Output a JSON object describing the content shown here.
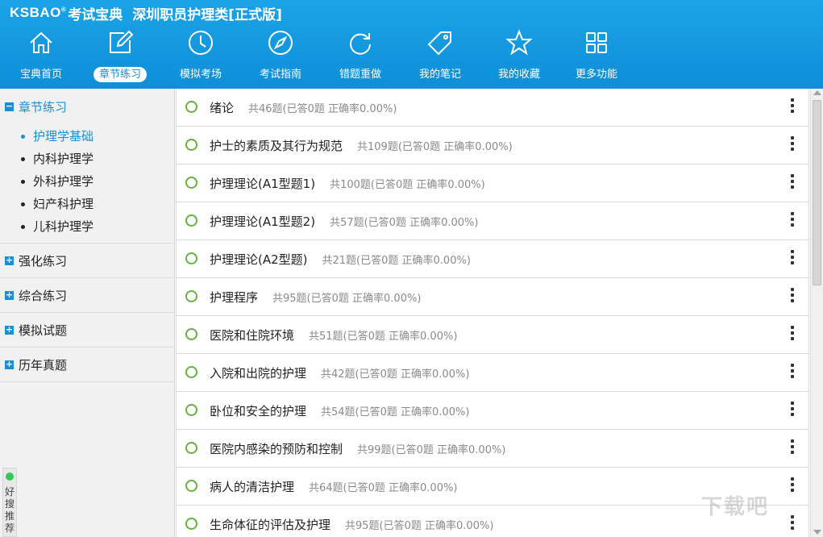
{
  "header": {
    "logo": "KSBAO",
    "brand": "考试宝典",
    "title": "深圳职员护理类[正式版]",
    "nav": [
      {
        "label": "宝典首页",
        "icon": "home-icon",
        "active": false
      },
      {
        "label": "章节练习",
        "icon": "edit-icon",
        "active": true
      },
      {
        "label": "模拟考场",
        "icon": "clock-icon",
        "active": false
      },
      {
        "label": "考试指南",
        "icon": "compass-icon",
        "active": false
      },
      {
        "label": "错题重做",
        "icon": "refresh-icon",
        "active": false
      },
      {
        "label": "我的笔记",
        "icon": "tag-icon",
        "active": false
      },
      {
        "label": "我的收藏",
        "icon": "star-icon",
        "active": false
      },
      {
        "label": "更多功能",
        "icon": "grid-icon",
        "active": false
      }
    ]
  },
  "sidebar": {
    "sections": [
      {
        "label": "章节练习",
        "expanded": true,
        "toggle": "−",
        "items": [
          {
            "label": "护理学基础",
            "active": true
          },
          {
            "label": "内科护理学",
            "active": false
          },
          {
            "label": "外科护理学",
            "active": false
          },
          {
            "label": "妇产科护理",
            "active": false
          },
          {
            "label": "儿科护理学",
            "active": false
          }
        ]
      },
      {
        "label": "强化练习",
        "expanded": false,
        "toggle": "+"
      },
      {
        "label": "综合练习",
        "expanded": false,
        "toggle": "+"
      },
      {
        "label": "模拟试题",
        "expanded": false,
        "toggle": "+"
      },
      {
        "label": "历年真题",
        "expanded": false,
        "toggle": "+"
      }
    ],
    "recommend": "好搜推荐"
  },
  "chapters": [
    {
      "name": "绪论",
      "stats": "共46题(已答0题   正确率0.00%)"
    },
    {
      "name": "护士的素质及其行为规范",
      "stats": "共109题(已答0题   正确率0.00%)"
    },
    {
      "name": "护理理论(A1型题1)",
      "stats": "共100题(已答0题   正确率0.00%)"
    },
    {
      "name": "护理理论(A1型题2)",
      "stats": "共57题(已答0题   正确率0.00%)"
    },
    {
      "name": "护理理论(A2型题)",
      "stats": "共21题(已答0题   正确率0.00%)"
    },
    {
      "name": "护理程序",
      "stats": "共95题(已答0题   正确率0.00%)"
    },
    {
      "name": "医院和住院环境",
      "stats": "共51题(已答0题   正确率0.00%)"
    },
    {
      "name": "入院和出院的护理",
      "stats": "共42题(已答0题   正确率0.00%)"
    },
    {
      "name": "卧位和安全的护理",
      "stats": "共54题(已答0题   正确率0.00%)"
    },
    {
      "name": "医院内感染的预防和控制",
      "stats": "共99题(已答0题   正确率0.00%)"
    },
    {
      "name": "病人的清洁护理",
      "stats": "共64题(已答0题   正确率0.00%)"
    },
    {
      "name": "生命体征的评估及护理",
      "stats": "共95题(已答0题   正确率0.00%)"
    }
  ],
  "watermark": "下载吧",
  "colors": {
    "accent": "#1a8fd3",
    "circle": "#64b33c"
  }
}
